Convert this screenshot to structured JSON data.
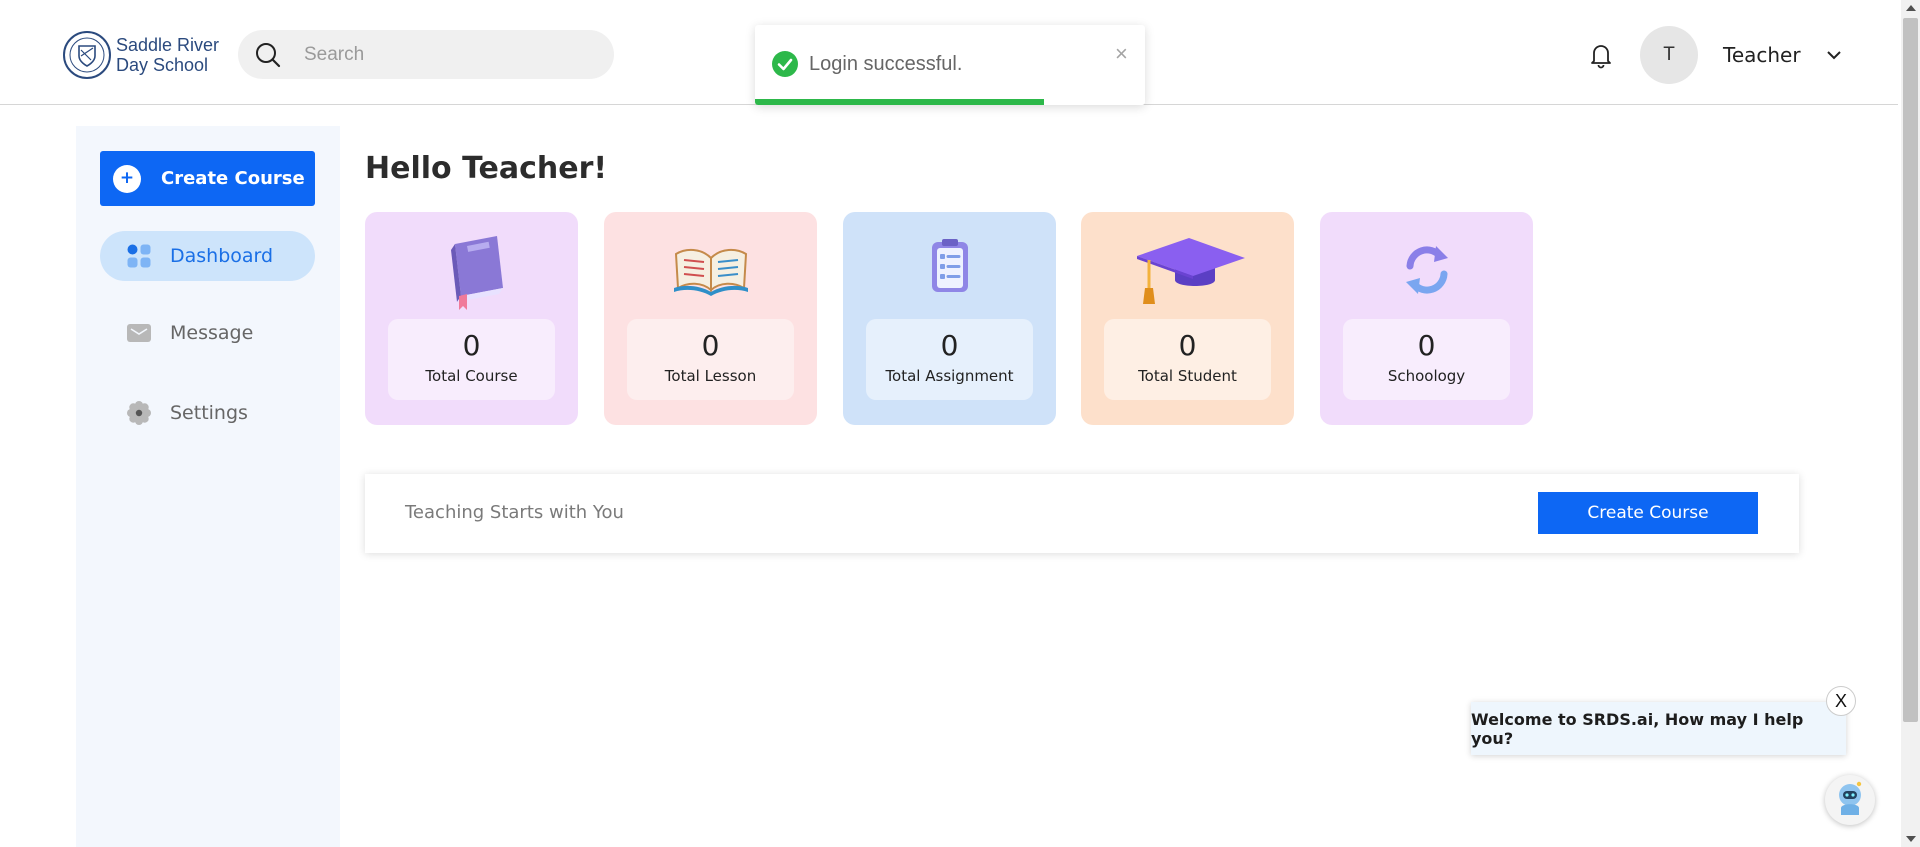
{
  "header": {
    "logo_line1": "Saddle River",
    "logo_line2": "Day School",
    "search_placeholder": "Search",
    "avatar_initial": "T",
    "user_name": "Teacher"
  },
  "toast": {
    "message": "Login successful.",
    "close_label": "×",
    "progress": 0.74,
    "accent_color": "#2db84a"
  },
  "sidebar": {
    "create_label": "Create Course",
    "items": [
      {
        "label": "Dashboard",
        "icon": "dashboard-grid-icon",
        "active": true
      },
      {
        "label": "Message",
        "icon": "envelope-icon",
        "active": false
      },
      {
        "label": "Settings",
        "icon": "gear-icon",
        "active": false
      }
    ]
  },
  "main": {
    "greeting": "Hello Teacher!",
    "cards": [
      {
        "count": "0",
        "label": "Total Course",
        "icon": "book-icon",
        "bg": "#f1dcfb",
        "inner": "#f8edfd"
      },
      {
        "count": "0",
        "label": "Total Lesson",
        "icon": "open-book-icon",
        "bg": "#fde1e2",
        "inner": "#fdeeee"
      },
      {
        "count": "0",
        "label": "Total Assignment",
        "icon": "clipboard-icon",
        "bg": "#cfe2f9",
        "inner": "#e6f0fc"
      },
      {
        "count": "0",
        "label": "Total Student",
        "icon": "graduation-cap-icon",
        "bg": "#fde0cb",
        "inner": "#feefe4"
      },
      {
        "count": "0",
        "label": "Schoology",
        "icon": "sync-icon",
        "bg": "#f1dcfb",
        "inner": "#f8edfd"
      }
    ],
    "banner_text": "Teaching Starts with You",
    "banner_button": "Create Course"
  },
  "chat": {
    "message": "Welcome to SRDS.ai, How may I help you?",
    "close_label": "X",
    "bot_icon": "robot-icon"
  },
  "colors": {
    "primary": "#0d67f4",
    "sidebar_bg": "#f3f7fd",
    "active_pill": "#cde4fb"
  }
}
